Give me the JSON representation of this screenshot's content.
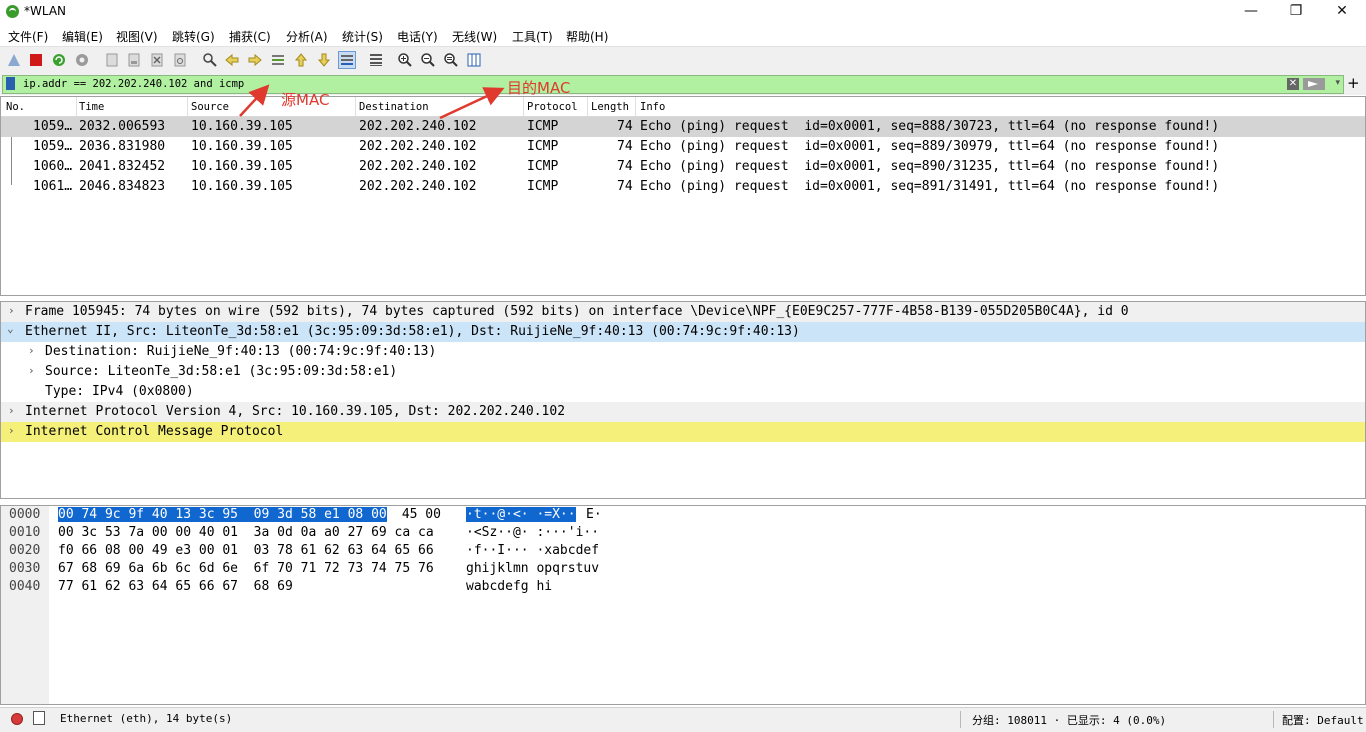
{
  "window": {
    "title": "*WLAN",
    "controls": {
      "minimize": "—",
      "maximize": "❐",
      "close": "✕"
    }
  },
  "menu": [
    "文件(F)",
    "编辑(E)",
    "视图(V)",
    "跳转(G)",
    "捕获(C)",
    "分析(A)",
    "统计(S)",
    "电话(Y)",
    "无线(W)",
    "工具(T)",
    "帮助(H)"
  ],
  "toolbar_icons": [
    "shark-fin-start-icon",
    "stop-capture-icon",
    "restart-capture-icon",
    "capture-options-icon",
    "open-file-icon",
    "save-file-icon",
    "close-file-icon",
    "reload-file-icon",
    "find-packet-icon",
    "go-back-icon",
    "go-forward-icon",
    "go-to-packet-icon",
    "go-first-icon",
    "go-last-icon",
    "autoscroll-icon",
    "colorize-icon",
    "zoom-in-icon",
    "zoom-out-icon",
    "normal-size-icon",
    "resize-columns-icon"
  ],
  "filter": {
    "text": "ip.addr == 202.202.240.102 and icmp",
    "clear": "✕",
    "dropdown": "▾",
    "add": "+"
  },
  "packet_list": {
    "columns": [
      "No.",
      "Time",
      "Source",
      "Destination",
      "Protocol",
      "Length",
      "Info"
    ],
    "rows": [
      {
        "no": "1059…",
        "time": "2032.006593",
        "source": "10.160.39.105",
        "destination": "202.202.240.102",
        "protocol": "ICMP",
        "length": "74",
        "info": "Echo (ping) request  id=0x0001, seq=888/30723, ttl=64 (no response found!)"
      },
      {
        "no": "1059…",
        "time": "2036.831980",
        "source": "10.160.39.105",
        "destination": "202.202.240.102",
        "protocol": "ICMP",
        "length": "74",
        "info": "Echo (ping) request  id=0x0001, seq=889/30979, ttl=64 (no response found!)"
      },
      {
        "no": "1060…",
        "time": "2041.832452",
        "source": "10.160.39.105",
        "destination": "202.202.240.102",
        "protocol": "ICMP",
        "length": "74",
        "info": "Echo (ping) request  id=0x0001, seq=890/31235, ttl=64 (no response found!)"
      },
      {
        "no": "1061…",
        "time": "2046.834823",
        "source": "10.160.39.105",
        "destination": "202.202.240.102",
        "protocol": "ICMP",
        "length": "74",
        "info": "Echo (ping) request  id=0x0001, seq=891/31491, ttl=64 (no response found!)"
      }
    ]
  },
  "details": [
    {
      "text": "Frame 105945: 74 bytes on wire (592 bits), 74 bytes captured (592 bits) on interface \\Device\\NPF_{E0E9C257-777F-4B58-B139-055D205B0C4A}, id 0",
      "arrow": "›"
    },
    {
      "text": "Ethernet II, Src: LiteonTe_3d:58:e1 (3c:95:09:3d:58:e1), Dst: RuijieNe_9f:40:13 (00:74:9c:9f:40:13)",
      "arrow": "⌄"
    },
    {
      "text": "Destination: RuijieNe_9f:40:13 (00:74:9c:9f:40:13)",
      "arrow": "›"
    },
    {
      "text": "Source: LiteonTe_3d:58:e1 (3c:95:09:3d:58:e1)",
      "arrow": "›"
    },
    {
      "text": "Type: IPv4 (0x0800)",
      "arrow": ""
    },
    {
      "text": "Internet Protocol Version 4, Src: 10.160.39.105, Dst: 202.202.240.102",
      "arrow": "›"
    },
    {
      "text": "Internet Control Message Protocol",
      "arrow": "›"
    }
  ],
  "bytes": [
    {
      "offset": "0000",
      "hex_sel": "00 74 9c 9f 40 13 3c 95  09 3d 58 e1 08 00",
      "hex_rest": " 45 00",
      "ascii_sel": "·t··@·<· ·=X··",
      "ascii_rest": "E·"
    },
    {
      "offset": "0010",
      "hex_sel": "",
      "hex_rest": "00 3c 53 7a 00 00 40 01  3a 0d 0a a0 27 69 ca ca",
      "ascii_sel": "",
      "ascii_rest": "·<Sz··@· :···'i··"
    },
    {
      "offset": "0020",
      "hex_sel": "",
      "hex_rest": "f0 66 08 00 49 e3 00 01  03 78 61 62 63 64 65 66",
      "ascii_sel": "",
      "ascii_rest": "·f··I··· ·xabcdef"
    },
    {
      "offset": "0030",
      "hex_sel": "",
      "hex_rest": "67 68 69 6a 6b 6c 6d 6e  6f 70 71 72 73 74 75 76",
      "ascii_sel": "",
      "ascii_rest": "ghijklmn opqrstuv"
    },
    {
      "offset": "0040",
      "hex_sel": "",
      "hex_rest": "77 61 62 63 64 65 66 67  68 69",
      "ascii_sel": "",
      "ascii_rest": "wabcdefg hi"
    }
  ],
  "status": {
    "field": "Ethernet (eth), 14 byte(s)",
    "packets": "分组: 108011 · 已显示: 4 (0.0%)",
    "profile": "配置: Default"
  },
  "annotations": {
    "source_mac": "源MAC",
    "dest_mac": "目的MAC"
  },
  "colors": {
    "filter_bg": "#b0f0a0",
    "selected_detail": "#cce4f7",
    "highlighted_detail": "#f5f07a",
    "hex_selection": "#1067d0",
    "annotation": "#e03a2e"
  }
}
